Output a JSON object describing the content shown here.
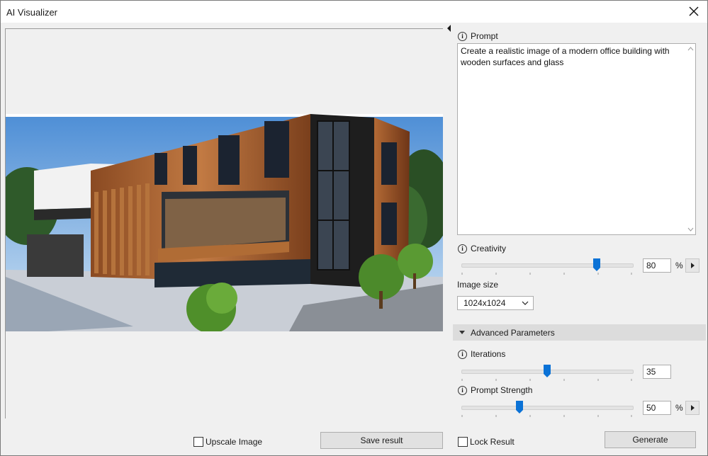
{
  "window": {
    "title": "AI Visualizer"
  },
  "left": {
    "upscale_label": "Upscale Image",
    "upscale_checked": false,
    "save_label": "Save result"
  },
  "right": {
    "prompt": {
      "label": "Prompt",
      "value": "Create a realistic image of a modern office building with wooden surfaces and glass"
    },
    "creativity": {
      "label": "Creativity",
      "value": "80",
      "unit": "%",
      "level": 0.8
    },
    "image_size": {
      "label": "Image size",
      "selected": "1024x1024"
    },
    "advanced": {
      "label": "Advanced Parameters",
      "expanded": true
    },
    "iterations": {
      "label": "Iterations",
      "value": "35",
      "level": 0.5
    },
    "prompt_strength": {
      "label": "Prompt Strength",
      "value": "50",
      "unit": "%",
      "level": 0.35
    },
    "lock_label": "Lock Result",
    "lock_checked": false,
    "generate_label": "Generate"
  },
  "colors": {
    "accent": "#0b72d6",
    "section_bg": "#dcdcdc",
    "panel_bg": "#f0f0f0"
  }
}
